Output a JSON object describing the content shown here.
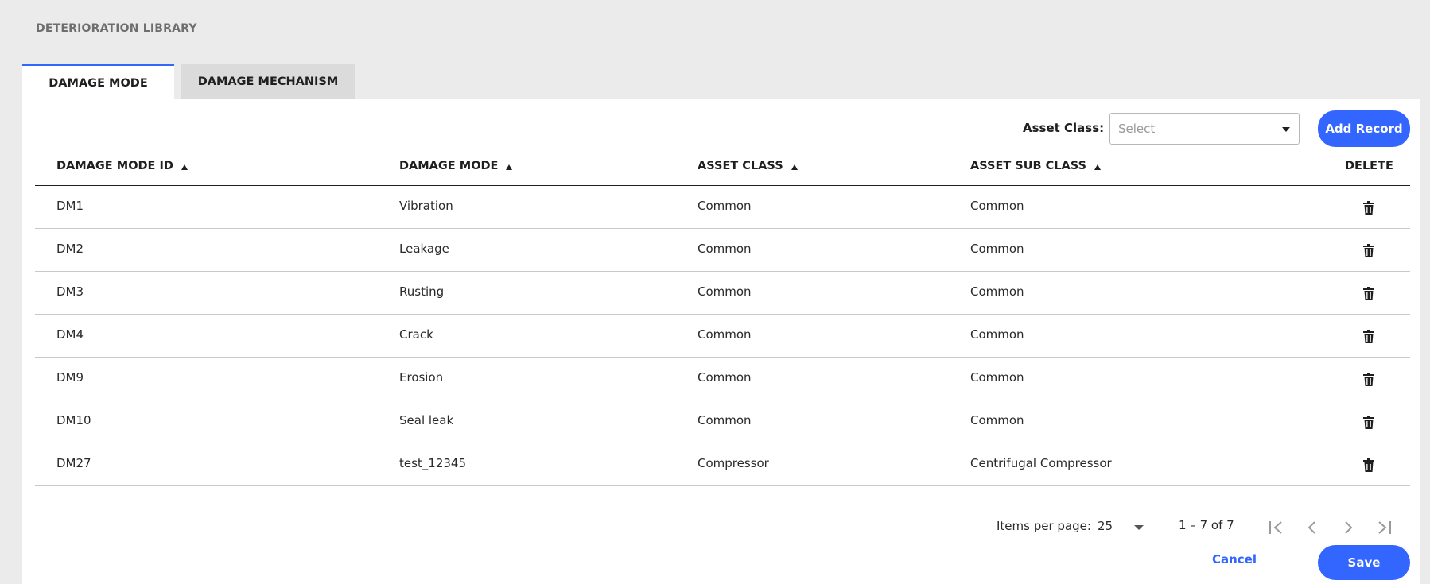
{
  "page": {
    "title": "DETERIORATION LIBRARY"
  },
  "tabs": [
    {
      "label": "DAMAGE MODE",
      "active": true
    },
    {
      "label": "DAMAGE MECHANISM",
      "active": false
    }
  ],
  "toolbar": {
    "asset_class_label": "Asset Class:",
    "asset_class_placeholder": "Select",
    "add_record_label": "Add Record"
  },
  "table": {
    "columns": [
      "DAMAGE MODE ID",
      "DAMAGE MODE",
      "ASSET CLASS",
      "ASSET SUB CLASS",
      "DELETE"
    ],
    "rows": [
      {
        "id": "DM1",
        "mode": "Vibration",
        "asset_class": "Common",
        "asset_sub_class": "Common"
      },
      {
        "id": "DM2",
        "mode": "Leakage",
        "asset_class": "Common",
        "asset_sub_class": "Common"
      },
      {
        "id": "DM3",
        "mode": "Rusting",
        "asset_class": "Common",
        "asset_sub_class": "Common"
      },
      {
        "id": "DM4",
        "mode": "Crack",
        "asset_class": "Common",
        "asset_sub_class": "Common"
      },
      {
        "id": "DM9",
        "mode": "Erosion",
        "asset_class": "Common",
        "asset_sub_class": "Common"
      },
      {
        "id": "DM10",
        "mode": "Seal leak",
        "asset_class": "Common",
        "asset_sub_class": "Common"
      },
      {
        "id": "DM27",
        "mode": "test_12345",
        "asset_class": "Compressor",
        "asset_sub_class": "Centrifugal Compressor"
      }
    ]
  },
  "pagination": {
    "items_per_page_label": "Items per page:",
    "items_per_page": "25",
    "range": "1 – 7 of 7"
  },
  "footer": {
    "cancel_label": "Cancel",
    "save_label": "Save"
  },
  "colors": {
    "accent": "#3366ff",
    "background": "#ebebeb",
    "panel": "#ffffff"
  },
  "icons": {
    "delete": "trash-icon",
    "sort": "sort-ascending-icon",
    "first_page": "first-page-icon",
    "prev_page": "chevron-left-icon",
    "next_page": "chevron-right-icon",
    "last_page": "last-page-icon"
  }
}
